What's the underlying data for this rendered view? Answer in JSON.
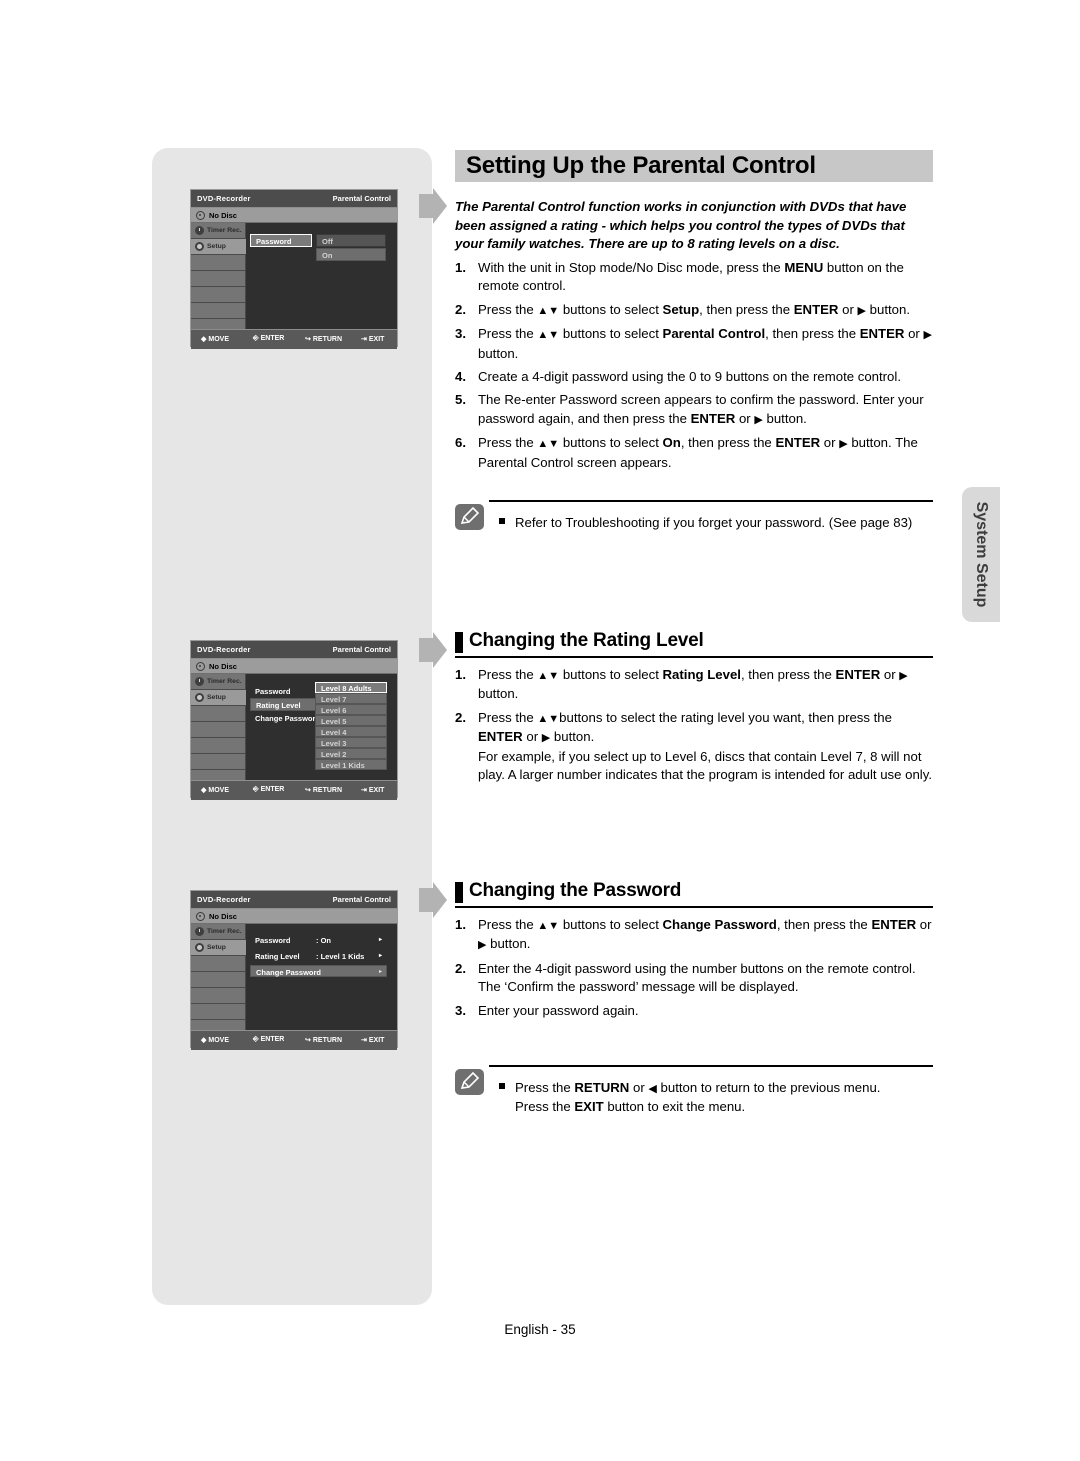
{
  "page": {
    "footer": "English - 35",
    "side_tab_label": "System Setup"
  },
  "header": {
    "title": "Setting Up the Parental Control"
  },
  "intro": "The Parental Control function works in conjunction with DVDs that have been assigned a rating - which helps you control the types of DVDs that your family watches. There are up to 8 rating levels on a disc.",
  "steps_main": [
    {
      "num": "1.",
      "html": "With the unit in Stop mode/No Disc mode, press the <b>MENU</b> button on the remote control."
    },
    {
      "num": "2.",
      "html": "Press the <span class=\"arw\">▲▼</span> buttons to select <b>Setup</b>, then press the <b>ENTER</b> or <span class=\"arw\">▶</span> button."
    },
    {
      "num": "3.",
      "html": "Press the <span class=\"arw\">▲▼</span> buttons to select <b>Parental Control</b>, then press the <b>ENTER</b> or <span class=\"arw\">▶</span> button."
    },
    {
      "num": "4.",
      "html": "Create a 4-digit password using the 0 to 9 buttons on the remote control."
    },
    {
      "num": "5.",
      "html": "The Re-enter Password screen appears to confirm the password. Enter your password again, and then press the <b>ENTER</b> or <span class=\"arw\">▶</span> button."
    },
    {
      "num": "6.",
      "html": "Press the <span class=\"arw\">▲▼</span> buttons to select <b>On</b>, then press the <b>ENTER</b> or <span class=\"arw\">▶</span> button. The Parental Control screen appears."
    }
  ],
  "note_top": {
    "text": "Refer to Troubleshooting if you forget your password. (See page 83)",
    "icon": "pencil-note-icon"
  },
  "section_rating": {
    "title": "Changing the Rating Level",
    "steps": [
      {
        "num": "1.",
        "html": "Press the <span class=\"arw\">▲▼</span> buttons to select <b>Rating Level</b>, then press the <b>ENTER</b> or <span class=\"arw\">▶</span> button."
      },
      {
        "num": "2.",
        "html": "Press the <span class=\"arw\">▲▼</span>buttons to select the rating level you want, then press the <b>ENTER</b> or <span class=\"arw\">▶</span> button.<br>For example, if you select up to Level 6, discs that contain Level 7, 8 will not play. A larger number indicates that the program is intended for adult use only."
      }
    ]
  },
  "section_password": {
    "title": "Changing the Password",
    "steps": [
      {
        "num": "1.",
        "html": "Press the <span class=\"arw\">▲▼</span> buttons to select <b>Change Password</b>, then press the <b>ENTER</b> or <span class=\"arw\">▶</span> button."
      },
      {
        "num": "2.",
        "html": "Enter the 4-digit password using the number buttons on the remote control.<br>The ‘Confirm the password’ message will be displayed."
      },
      {
        "num": "3.",
        "html": "Enter your password again."
      }
    ]
  },
  "note_bottom": {
    "html": "Press the <b>RETURN</b> or <span class=\"arw\">◀</span> button to return to the previous menu.<br>Press the <b>EXIT</b> button to exit the menu.",
    "icon": "pencil-note-icon"
  },
  "osd_common": {
    "device_label": "DVD-Recorder",
    "screen_label": "Parental Control",
    "no_disc": "No Disc",
    "sidebar": [
      {
        "label": "Timer Rec.",
        "icon": "timer-rec-icon"
      },
      {
        "label": "Setup",
        "icon": "gear-icon"
      }
    ],
    "footer_items": [
      {
        "icon": "dpad-icon",
        "label": "MOVE"
      },
      {
        "icon": "enter-icon",
        "label": "ENTER"
      },
      {
        "icon": "return-icon",
        "label": "RETURN"
      },
      {
        "icon": "exit-icon",
        "label": "EXIT"
      }
    ]
  },
  "osd1": {
    "menu_label": "Password",
    "options": [
      {
        "label": "Off",
        "selected": true
      },
      {
        "label": "On",
        "selected": false
      }
    ]
  },
  "osd2": {
    "menu_items": [
      {
        "label": "Password",
        "selected": false
      },
      {
        "label": "Rating Level",
        "selected": true
      },
      {
        "label": "Change Passwor",
        "selected": false
      }
    ],
    "levels": [
      {
        "label": "Level  8 Adults",
        "selected": true
      },
      {
        "label": "Level  7",
        "selected": false
      },
      {
        "label": "Level  6",
        "selected": false
      },
      {
        "label": "Level  5",
        "selected": false
      },
      {
        "label": "Level  4",
        "selected": false
      },
      {
        "label": "Level  3",
        "selected": false
      },
      {
        "label": "Level  2",
        "selected": false
      },
      {
        "label": "Level  1 Kids",
        "selected": false
      }
    ]
  },
  "osd3": {
    "rows": [
      {
        "label": "Password",
        "value": ": On",
        "selected": false,
        "arrow": "▸"
      },
      {
        "label": "Rating Level",
        "value": ": Level 1 Kids",
        "selected": false,
        "arrow": "▸"
      },
      {
        "label": "Change Password",
        "value": "",
        "selected": true,
        "arrow": "▸"
      }
    ]
  },
  "colors": {
    "heading_band": "#c7c7c7",
    "panel": "#e6e6e6",
    "side_tab": "#d9d9d9",
    "osd_bg": "#3c3c3c"
  }
}
